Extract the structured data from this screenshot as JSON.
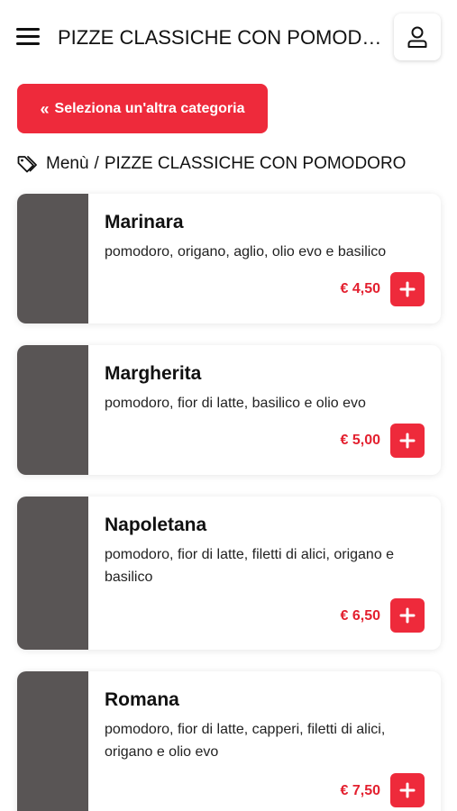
{
  "header": {
    "title": "PIZZE CLASSICHE CON POMODORO"
  },
  "category_button": {
    "label": "Seleziona un'altra categoria"
  },
  "breadcrumb": {
    "root": "Menù",
    "separator": "/",
    "current": "PIZZE CLASSICHE CON POMODORO"
  },
  "products": [
    {
      "name": "Marinara",
      "description": "pomodoro, origano, aglio, olio evo e basilico",
      "price": "€ 4,50"
    },
    {
      "name": "Margherita",
      "description": "pomodoro, fior di latte, basilico e olio evo",
      "price": "€ 5,00"
    },
    {
      "name": "Napoletana",
      "description": "pomodoro, fior di latte, filetti di alici, origano e basilico",
      "price": "€ 6,50"
    },
    {
      "name": "Romana",
      "description": "pomodoro, fior di latte, capperi, filetti di alici, origano e olio evo",
      "price": "€ 7,50"
    }
  ],
  "colors": {
    "accent": "#ee2a3b",
    "price": "#e3202f",
    "thumbnail_placeholder": "#595555"
  }
}
